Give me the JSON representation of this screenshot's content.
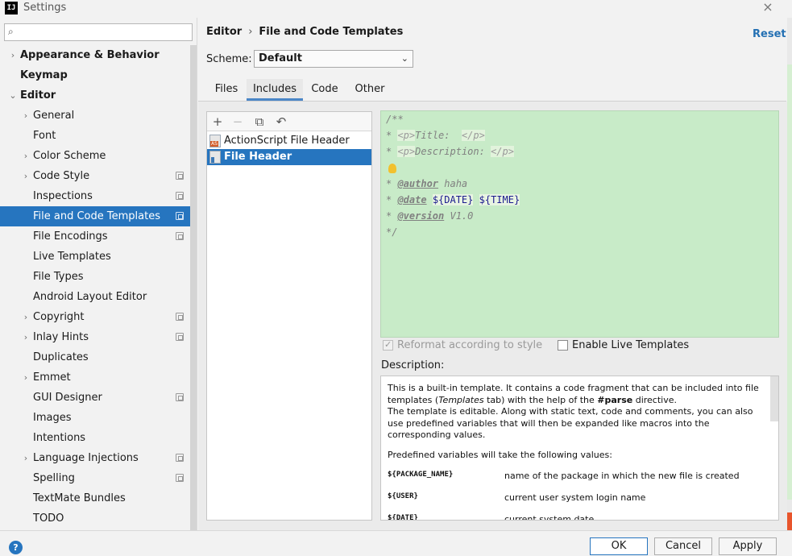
{
  "window": {
    "title": "Settings",
    "logo": "IJ",
    "close_icon": "×"
  },
  "search": {
    "placeholder": "",
    "icon": "search-icon"
  },
  "sidebar": {
    "items": [
      {
        "label": "Appearance & Behavior",
        "level": 0,
        "arrow": "›",
        "bold": true,
        "pg": false
      },
      {
        "label": "Keymap",
        "level": 0,
        "arrow": "",
        "bold": true,
        "pg": false
      },
      {
        "label": "Editor",
        "level": 0,
        "arrow": "⌄",
        "bold": true,
        "pg": false
      },
      {
        "label": "General",
        "level": 1,
        "arrow": "›",
        "pg": false
      },
      {
        "label": "Font",
        "level": 1,
        "arrow": "",
        "pg": false
      },
      {
        "label": "Color Scheme",
        "level": 1,
        "arrow": "›",
        "pg": false
      },
      {
        "label": "Code Style",
        "level": 1,
        "arrow": "›",
        "pg": true
      },
      {
        "label": "Inspections",
        "level": 1,
        "arrow": "",
        "pg": true
      },
      {
        "label": "File and Code Templates",
        "level": 1,
        "arrow": "",
        "pg": true,
        "selected": true
      },
      {
        "label": "File Encodings",
        "level": 1,
        "arrow": "",
        "pg": true
      },
      {
        "label": "Live Templates",
        "level": 1,
        "arrow": "",
        "pg": false
      },
      {
        "label": "File Types",
        "level": 1,
        "arrow": "",
        "pg": false
      },
      {
        "label": "Android Layout Editor",
        "level": 1,
        "arrow": "",
        "pg": false
      },
      {
        "label": "Copyright",
        "level": 1,
        "arrow": "›",
        "pg": true
      },
      {
        "label": "Inlay Hints",
        "level": 1,
        "arrow": "›",
        "pg": true
      },
      {
        "label": "Duplicates",
        "level": 1,
        "arrow": "",
        "pg": false
      },
      {
        "label": "Emmet",
        "level": 1,
        "arrow": "›",
        "pg": false
      },
      {
        "label": "GUI Designer",
        "level": 1,
        "arrow": "",
        "pg": true
      },
      {
        "label": "Images",
        "level": 1,
        "arrow": "",
        "pg": false
      },
      {
        "label": "Intentions",
        "level": 1,
        "arrow": "",
        "pg": false
      },
      {
        "label": "Language Injections",
        "level": 1,
        "arrow": "›",
        "pg": true
      },
      {
        "label": "Spelling",
        "level": 1,
        "arrow": "",
        "pg": true
      },
      {
        "label": "TextMate Bundles",
        "level": 1,
        "arrow": "",
        "pg": false
      },
      {
        "label": "TODO",
        "level": 1,
        "arrow": "",
        "pg": false
      }
    ]
  },
  "breadcrumb": {
    "parent": "Editor",
    "separator": "›",
    "current": "File and Code Templates"
  },
  "reset_label": "Reset",
  "scheme": {
    "label": "Scheme:",
    "value": "Default"
  },
  "tabs": [
    {
      "label": "Files",
      "active": false
    },
    {
      "label": "Includes",
      "active": true
    },
    {
      "label": "Code",
      "active": false
    },
    {
      "label": "Other",
      "active": false
    }
  ],
  "list_toolbar": {
    "add": "+",
    "remove": "−",
    "copy": "⧉",
    "reset": "↶"
  },
  "templates": [
    {
      "name": "ActionScript File Header",
      "icon": "actionscript-file-icon",
      "selected": false
    },
    {
      "name": "File Header",
      "icon": "java-file-icon",
      "selected": true
    }
  ],
  "editor": {
    "lines": {
      "l1": "/**",
      "l2_star": "* ",
      "l2_open": "<p>",
      "l2_text": "Title:  ",
      "l2_close": "</p>",
      "l3_star": "* ",
      "l3_open": "<p>",
      "l3_text": "Description: ",
      "l3_close": "</p>",
      "l5_star": "* ",
      "l5_tag": "@author",
      "l5_val": " haha",
      "l6_star": "* ",
      "l6_tag": "@date",
      "l6_var1": "${DATE}",
      "l6_var2": "${TIME}",
      "l7_star": "* ",
      "l7_tag": "@version",
      "l7_val": " V1.0",
      "l8": "*/"
    }
  },
  "options": {
    "reformat_label": "Reformat according to style",
    "live_templates_label": "Enable Live Templates"
  },
  "description": {
    "label": "Description:",
    "p1_a": "This is a built-in template. It contains a code fragment that can be included into file templates (",
    "p1_em": "Templates",
    "p1_b": " tab) with the help of the ",
    "p1_strong": "#parse",
    "p1_c": " directive.",
    "p2": "The template is editable. Along with static text, code and comments, you can also use predefined variables that will then be expanded like macros into the corresponding values.",
    "p3": "Predefined variables will take the following values:",
    "vars": [
      {
        "name": "${PACKAGE_NAME}",
        "desc": "name of the package in which the new file is created"
      },
      {
        "name": "${USER}",
        "desc": "current user system login name"
      },
      {
        "name": "${DATE}",
        "desc": "current system date"
      }
    ]
  },
  "footer": {
    "help": "?",
    "ok": "OK",
    "cancel": "Cancel",
    "apply": "Apply"
  }
}
